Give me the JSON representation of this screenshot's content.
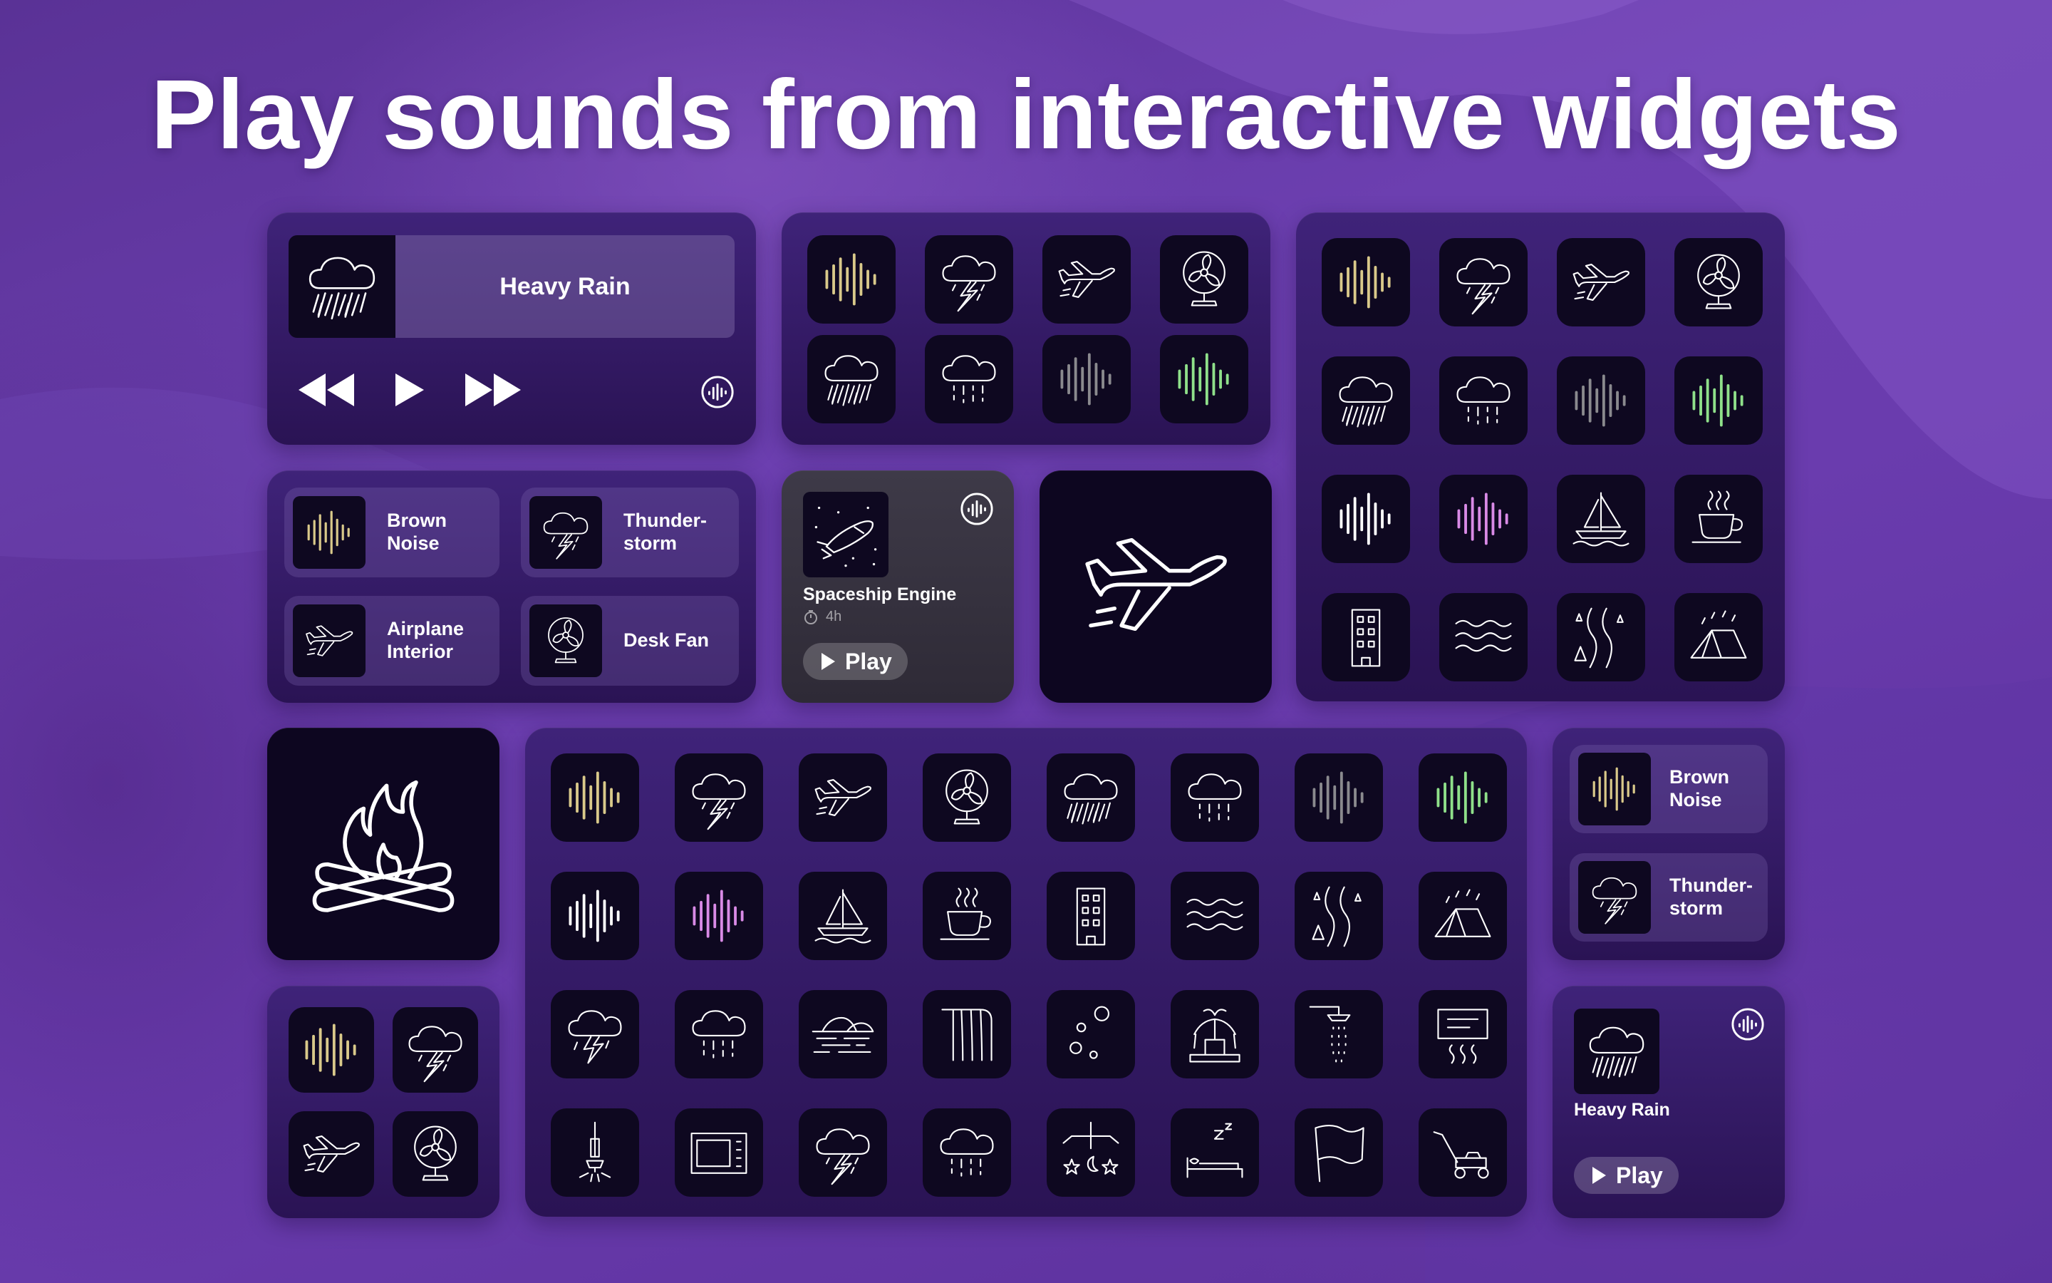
{
  "headline": "Play sounds from interactive widgets",
  "now_playing": {
    "title": "Heavy Rain",
    "controls": [
      "rewind",
      "play",
      "fast-forward"
    ]
  },
  "pills_medium": [
    {
      "label": "Brown Noise",
      "icon": "brown-noise"
    },
    {
      "label": "Thunder-\nstorm",
      "icon": "thunderstorm"
    },
    {
      "label": "Airplane\nInterior",
      "icon": "airplane"
    },
    {
      "label": "Desk Fan",
      "icon": "desk-fan"
    }
  ],
  "spaceship_widget": {
    "title": "Spaceship Engine",
    "duration": "4h",
    "play_label": "Play"
  },
  "pills_small": [
    {
      "label": "Brown\nNoise",
      "icon": "brown-noise"
    },
    {
      "label": "Thunder-\nstorm",
      "icon": "thunderstorm"
    }
  ],
  "heavy_rain_widget": {
    "title": "Heavy Rain",
    "play_label": "Play"
  },
  "large_grid_icons": [
    "brown-noise",
    "thunderstorm",
    "airplane",
    "desk-fan",
    "heavy-rain",
    "light-rain",
    "gray-noise",
    "green-noise",
    "white-noise",
    "pink-noise",
    "sailboat",
    "coffee-cup",
    "office-building",
    "ocean-waves",
    "river-rain",
    "tent-rain"
  ],
  "xl_grid_icons": [
    "brown-noise",
    "thunderstorm",
    "airplane",
    "desk-fan",
    "heavy-rain",
    "light-rain",
    "gray-noise",
    "green-noise",
    "white-noise",
    "pink-noise",
    "sailboat",
    "coffee-cup",
    "office-building",
    "ocean-waves",
    "river-rain",
    "tent-rain",
    "lightning-cloud",
    "drizzle-cloud",
    "sunset-lake",
    "waterfall",
    "bubbles",
    "fountain",
    "shower",
    "air-conditioner",
    "vacuum",
    "microwave",
    "storm",
    "rain-cloud",
    "baby-mobile",
    "sleeping",
    "flag",
    "lawn-mower"
  ],
  "colors": {
    "brown_noise": "#d9c98a",
    "gray_noise": "#8a8a8e",
    "green_noise": "#8fe08a",
    "white_noise": "#ffffff",
    "pink_noise": "#d98ae6"
  }
}
